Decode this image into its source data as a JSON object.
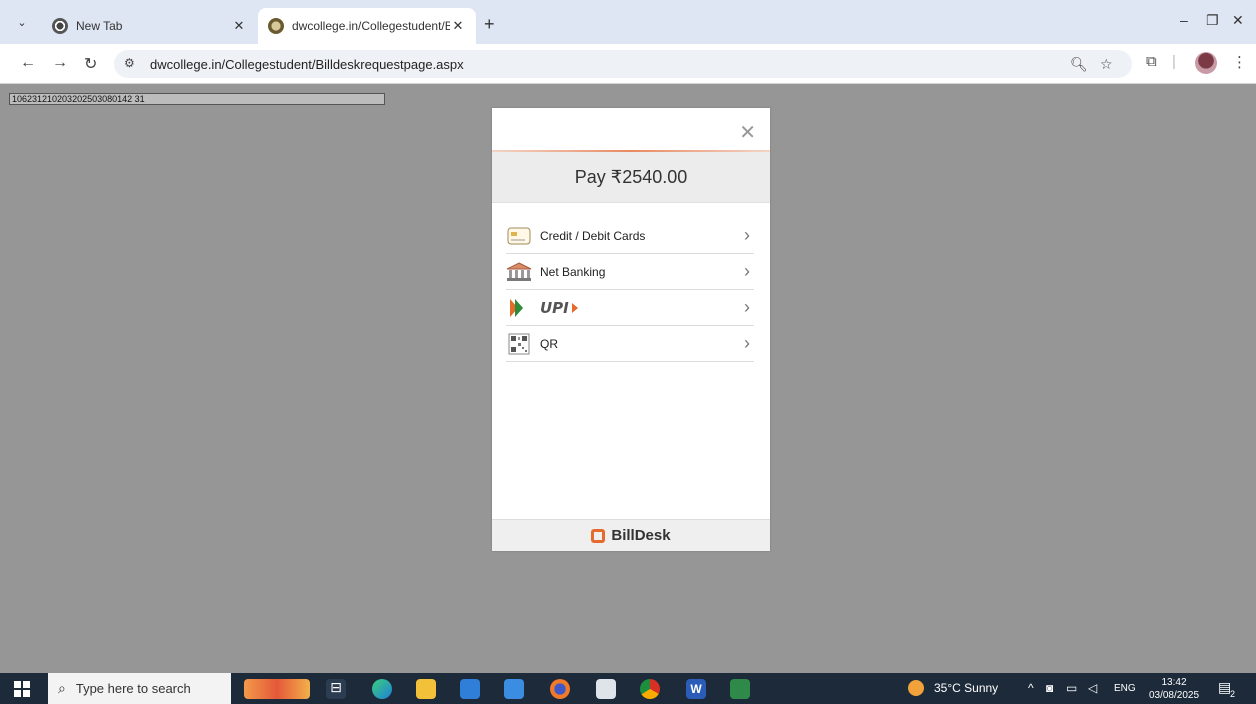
{
  "browser": {
    "tabs": [
      {
        "title": "New Tab"
      },
      {
        "title": "dwcollege.in/Collegestudent/Bi"
      }
    ],
    "url": "dwcollege.in/Collegestudent/Billdeskrequestpage.aspx"
  },
  "page": {
    "transaction_id": "106231210203202503080142 31"
  },
  "modal": {
    "pay_text": "Pay ₹2540.00",
    "options": [
      {
        "label": "Credit / Debit Cards",
        "icon": "credit-card-icon"
      },
      {
        "label": "Net Banking",
        "icon": "bank-icon"
      },
      {
        "label": "UPI",
        "icon": "upi-logo-icon"
      },
      {
        "label": "QR",
        "icon": "qr-code-icon"
      }
    ],
    "footer_brand": "BillDesk"
  },
  "taskbar": {
    "search_placeholder": "Type here to search",
    "weather": "35°C  Sunny",
    "language": "ENG",
    "time": "13:42",
    "date": "03/08/2025",
    "notification_count": "2"
  },
  "colors": {
    "page_overlay": "#969696",
    "accent_orange": "#e46b2c",
    "taskbar": "#1c2a3a"
  }
}
